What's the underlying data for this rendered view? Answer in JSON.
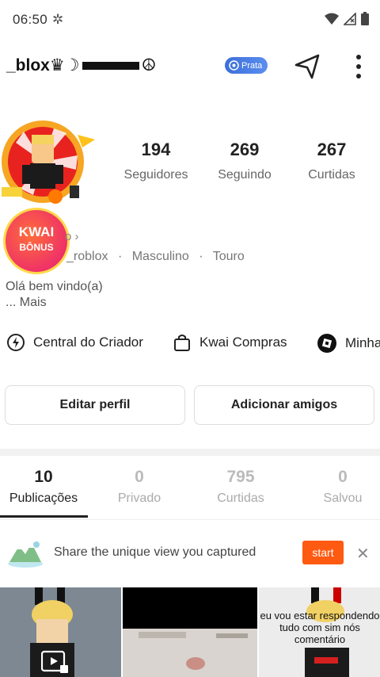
{
  "status_bar": {
    "time": "06:50",
    "icons": [
      "settings-icon",
      "wifi-icon",
      "signal-icon",
      "battery-icon"
    ]
  },
  "header": {
    "username": "_blox♛☽",
    "username_tail": "☮",
    "level_badge": "Prata",
    "colors": {
      "badge": "#4a7fe6"
    }
  },
  "stats": [
    {
      "value": "194",
      "label": "Seguidores"
    },
    {
      "value": "269",
      "label": "Seguindo"
    },
    {
      "value": "267",
      "label": "Curtidas"
    }
  ],
  "bonus": {
    "line1": "KWAI",
    "line2": "BÔNUS"
  },
  "profile": {
    "link_text": "o ›",
    "handle": "_roblox",
    "gender": "Masculino",
    "sign": "Touro",
    "separator": "·",
    "bio_line1": "Olá bem vindo(a)",
    "bio_more": "...  Mais"
  },
  "shortcuts": [
    {
      "label": "Central do Criador",
      "icon": "creator-center-icon"
    },
    {
      "label": "Kwai Compras",
      "icon": "shopping-bag-icon"
    },
    {
      "label": "Minha",
      "icon": "roblox-icon"
    }
  ],
  "actions": {
    "edit": "Editar perfil",
    "add": "Adicionar amigos"
  },
  "tabs": [
    {
      "count": "10",
      "label": "Publicações"
    },
    {
      "count": "0",
      "label": "Privado"
    },
    {
      "count": "795",
      "label": "Curtidas"
    },
    {
      "count": "0",
      "label": "Salvou"
    }
  ],
  "banner": {
    "text": "Share the unique view you captured",
    "button": "start",
    "colors": {
      "button": "#ff5a12"
    }
  },
  "grid": {
    "caption3": "eu vou estar respondendo tudo com sim nós comentário"
  }
}
